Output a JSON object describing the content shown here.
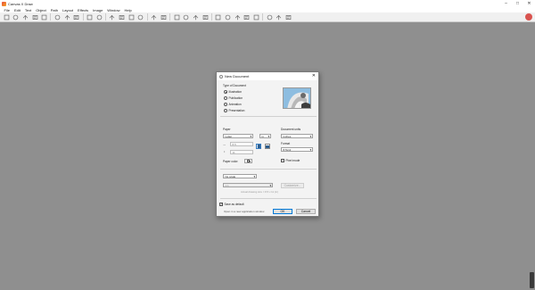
{
  "app": {
    "title": "Canvas X Draw"
  },
  "window_controls": [
    "–",
    "□",
    "✕"
  ],
  "menu": [
    "File",
    "Edit",
    "Text",
    "Object",
    "Path",
    "Layout",
    "Effects",
    "Image",
    "Window",
    "Help"
  ],
  "toolbar_icons": [
    "new-document-icon",
    "open-icon",
    "save-icon",
    "print-icon",
    "export-icon",
    "cut-icon",
    "copy-icon",
    "paste-icon",
    "undo-icon",
    "redo-icon",
    "zoom-in-icon",
    "zoom-out-icon",
    "hand-icon",
    "rotate-icon",
    "import-icon",
    "share-icon",
    "group-icon",
    "ungroup-icon",
    "transform-icon",
    "link-icon",
    "align-icon",
    "image-icon",
    "chat-icon",
    "screen-icon",
    "layout-icon",
    "camera-icon",
    "grid-icon",
    "chart-icon"
  ],
  "dialog": {
    "title": "New Document",
    "close": "✕",
    "type_label": "Type of Document",
    "types": [
      {
        "label": "Illustration",
        "selected": true
      },
      {
        "label": "Publication",
        "selected": false
      },
      {
        "label": "Animation",
        "selected": false
      },
      {
        "label": "Presentation",
        "selected": false
      }
    ],
    "paper_label": "Paper",
    "paper_value": "Letter",
    "paper_orientation": "in",
    "width_value": "8.5",
    "height_value": "11",
    "units_label": "Document units",
    "units_value": "Inches",
    "format_label": "Format",
    "format_value": "8.5x11",
    "pixel_mode_label": "Pixel mode",
    "paper_color_label": "Paper color:",
    "scale_value": "No scale",
    "scale_sub_value": "1:1",
    "customize_label": "Customize...",
    "actual_size_text": "Actual drawing size = 8.5 x 11 (in)",
    "save_default_label": "Save as default",
    "open_new_window_text": "Open in a new application window",
    "ok_label": "OK",
    "cancel_label": "Cancel"
  }
}
